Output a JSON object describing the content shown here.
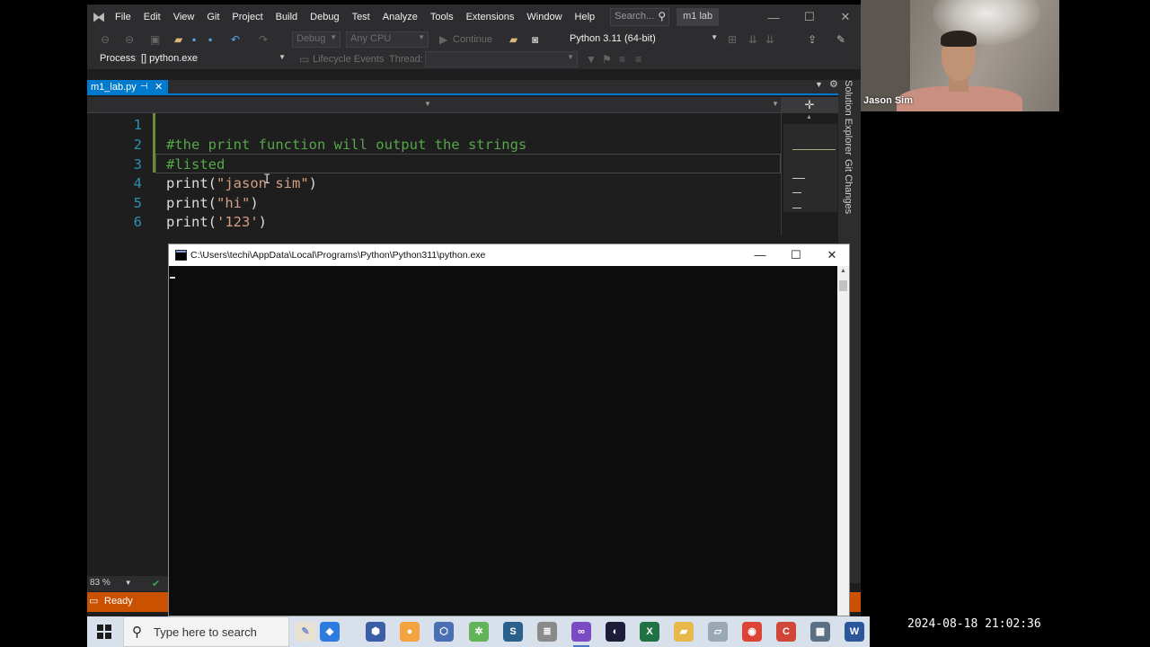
{
  "vs": {
    "menu": [
      "File",
      "Edit",
      "View",
      "Git",
      "Project",
      "Build",
      "Debug",
      "Test",
      "Analyze",
      "Tools",
      "Extensions",
      "Window",
      "Help"
    ],
    "search_placeholder": "Search...",
    "solution_name": "m1 lab",
    "toolbar": {
      "config": "Debug",
      "platform": "Any CPU",
      "continue": "Continue",
      "interpreter": "Python 3.11 (64-bit)"
    },
    "toolbar2": {
      "process_label": "Process:",
      "process_value": "[] python.exe",
      "lifecycle": "Lifecycle Events",
      "thread_label": "Thread:"
    },
    "tab": {
      "name": "m1_lab.py",
      "pin": "⊣",
      "close": "✕"
    },
    "side_panel": [
      "Solution Explorer",
      "Git Changes"
    ],
    "code": {
      "line_numbers": [
        "1",
        "2",
        "3",
        "4",
        "5",
        "6"
      ],
      "lines": [
        {
          "plain": ""
        },
        {
          "comment": "#the print function will output the strings"
        },
        {
          "comment": "#listed"
        },
        {
          "fn": "print(",
          "str": "\"jason sim\"",
          "end": ")"
        },
        {
          "fn": "print(",
          "str": "\"hi\"",
          "end": ")"
        },
        {
          "fn": "print(",
          "str": "'123'",
          "end": ")"
        }
      ]
    },
    "zoom": "83 %",
    "status": "Ready"
  },
  "console": {
    "title": "C:\\Users\\techi\\AppData\\Local\\Programs\\Python\\Python311\\python.exe",
    "minimize": "—",
    "maximize": "☐",
    "close": "✕"
  },
  "webcam": {
    "name": "Jason Sim"
  },
  "taskbar": {
    "search_placeholder": "Type here to search"
  },
  "timestamp": "2024-08-18 21:02:36"
}
